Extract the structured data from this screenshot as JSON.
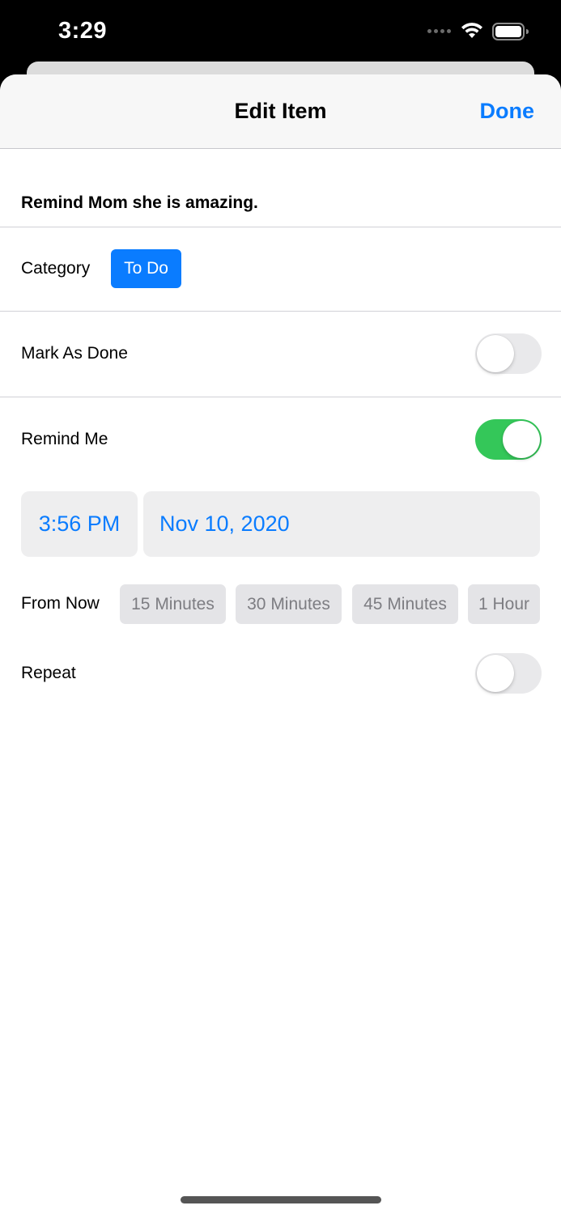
{
  "status_bar": {
    "time": "3:29",
    "icons": [
      "signal-icon",
      "wifi-icon",
      "battery-icon"
    ]
  },
  "nav": {
    "title": "Edit Item",
    "done_label": "Done"
  },
  "item": {
    "title": "Remind Mom she is amazing."
  },
  "category": {
    "label": "Category",
    "value": "To Do"
  },
  "mark_as_done": {
    "label": "Mark As Done",
    "on": false
  },
  "remind_me": {
    "label": "Remind Me",
    "on": true,
    "time": "3:56 PM",
    "date": "Nov 10, 2020"
  },
  "from_now": {
    "label": "From Now",
    "options": [
      "15 Minutes",
      "30 Minutes",
      "45 Minutes",
      "1 Hour"
    ]
  },
  "repeat": {
    "label": "Repeat",
    "on": false
  },
  "colors": {
    "accent": "#0a7cff",
    "toggle_on": "#34c759",
    "toggle_off": "#e9e9eb"
  }
}
